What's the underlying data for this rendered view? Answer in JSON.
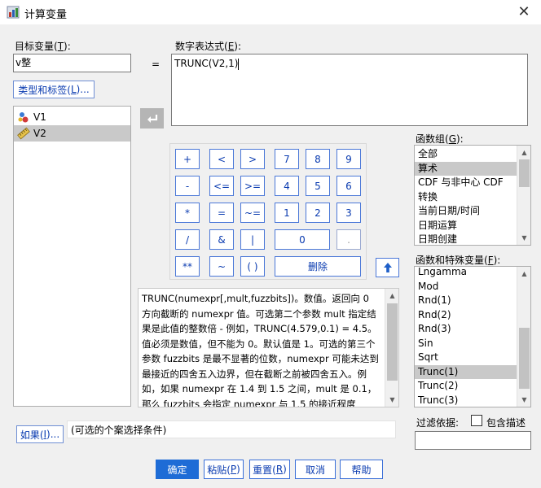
{
  "window": {
    "title": "计算变量"
  },
  "target": {
    "label": "目标变量(T):",
    "value": "v整",
    "type_label_button": "类型和标签(L)...",
    "equals": "="
  },
  "expression": {
    "label": "数字表达式(E):",
    "value": "TRUNC(V2,1)"
  },
  "variables": [
    {
      "name": "V1",
      "icon": "nominal-variable-icon"
    },
    {
      "name": "V2",
      "icon": "scale-variable-icon",
      "selected": true
    }
  ],
  "transfer_arrow": "transfer-arrow-icon",
  "keypad": {
    "rows": [
      [
        "+",
        "<",
        ">",
        "7",
        "8",
        "9"
      ],
      [
        "-",
        "<=",
        ">=",
        "4",
        "5",
        "6"
      ],
      [
        "*",
        "=",
        "~=",
        "1",
        "2",
        "3"
      ],
      [
        "/",
        "&",
        "|",
        "0",
        "."
      ],
      [
        "**",
        "~",
        "( )",
        "删除"
      ]
    ],
    "up_arrow": "up-arrow-icon"
  },
  "description": "TRUNC(numexpr[,mult,fuzzbits])。数值。返回向 0 方向截断的 numexpr 值。可选第二个参数 mult 指定结果是此值的整数倍 - 例如，TRUNC(4.579,0.1) = 4.5。值必须是数值，但不能为 0。默认值是 1。可选的第三个参数 fuzzbits 是最不显著的位数，numexpr 可能未达到最接近的四舍五入边界，但在截断之前被四舍五入。例如，如果 numexpr 在 1.4 到 1.5 之间，mult 是 0.1，那么 fuzzbits 会指定 numexpr 与 1.5 的接近程度",
  "function_groups": {
    "label": "函数组(G):",
    "items": [
      "全部",
      "算术",
      "CDF 与非中心 CDF",
      "转换",
      "当前日期/时间",
      "日期运算",
      "日期创建"
    ],
    "selected_index": 1
  },
  "functions": {
    "label": "函数和特殊变量(F):",
    "items": [
      "Lngamma",
      "Mod",
      "Rnd(1)",
      "Rnd(2)",
      "Rnd(3)",
      "Sin",
      "Sqrt",
      "Trunc(1)",
      "Trunc(2)",
      "Trunc(3)"
    ],
    "selected_index": 7
  },
  "filter": {
    "label": "过滤依据:",
    "checkbox_label": "包含描述",
    "value": ""
  },
  "if_section": {
    "button": "如果(I)...",
    "text": "(可选的个案选择条件)"
  },
  "buttons": {
    "ok": "确定",
    "paste": "粘贴(P)",
    "reset": "重置(R)",
    "cancel": "取消",
    "help": "帮助"
  }
}
